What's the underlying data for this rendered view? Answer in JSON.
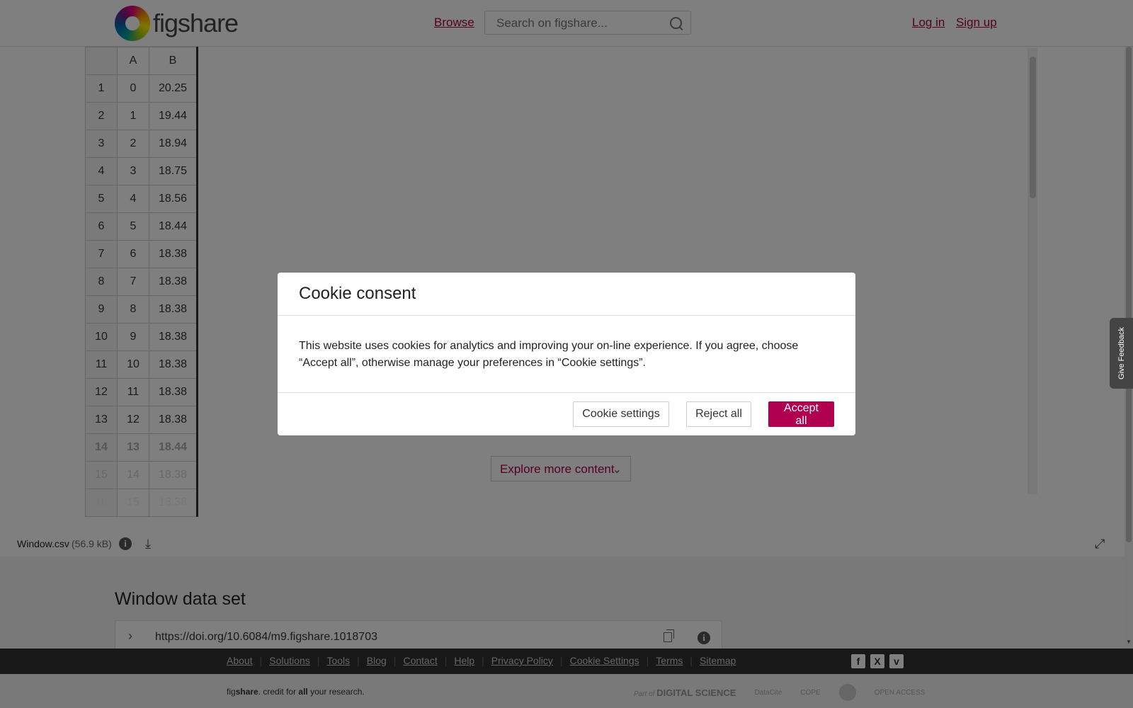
{
  "header": {
    "logo_text": "figshare",
    "browse_label": "Browse",
    "search_placeholder": "Search on figshare...",
    "login_label": "Log in",
    "signup_label": "Sign up"
  },
  "grid": {
    "headers": [
      "",
      "A",
      "B"
    ],
    "rows": [
      [
        "1",
        "0",
        "20.25"
      ],
      [
        "2",
        "1",
        "19.44"
      ],
      [
        "3",
        "2",
        "18.94"
      ],
      [
        "4",
        "3",
        "18.75"
      ],
      [
        "5",
        "4",
        "18.56"
      ],
      [
        "6",
        "5",
        "18.44"
      ],
      [
        "7",
        "6",
        "18.38"
      ],
      [
        "8",
        "7",
        "18.38"
      ],
      [
        "9",
        "8",
        "18.38"
      ],
      [
        "10",
        "9",
        "18.38"
      ],
      [
        "11",
        "10",
        "18.38"
      ],
      [
        "12",
        "11",
        "18.38"
      ],
      [
        "13",
        "12",
        "18.38"
      ],
      [
        "14",
        "13",
        "18.44"
      ],
      [
        "15",
        "14",
        "18.38"
      ],
      [
        "16",
        "15",
        "18.38"
      ]
    ]
  },
  "explore_label": "Explore more content",
  "feedback_label": "Give Feedback",
  "file": {
    "name": "Window.csv",
    "size": "(56.9 kB)"
  },
  "item_title": "Window data set",
  "doi": "https://doi.org/10.6084/m9.figshare.1018703",
  "footer": {
    "links": [
      "About",
      "Solutions",
      "Tools",
      "Blog",
      "Contact",
      "Help",
      "Privacy Policy",
      "Cookie Settings",
      "Terms",
      "Sitemap"
    ],
    "social": [
      "f",
      "X",
      "v"
    ],
    "tagline_pre": "fig",
    "tagline_bold": "share",
    "tagline_mid": ". credit for ",
    "tagline_all": "all",
    "tagline_end": " your research.",
    "partner_ds_pre": "Part of",
    "partner_ds_name": "DIGITAL SCIENCE",
    "partner_datacite": "DataCite",
    "partner_cope": "COPE",
    "partner_oa": "OPEN ACCESS"
  },
  "modal": {
    "title": "Cookie consent",
    "body": "This website uses cookies for analytics and improving your on-line experience. If you agree, choose “Accept all”, otherwise manage your preferences in “Cookie settings”.",
    "settings_label": "Cookie settings",
    "reject_label": "Reject all",
    "accept_label": "Accept all"
  },
  "colors": {
    "brand": "#aa0047",
    "accept_button": "#b0004f"
  }
}
